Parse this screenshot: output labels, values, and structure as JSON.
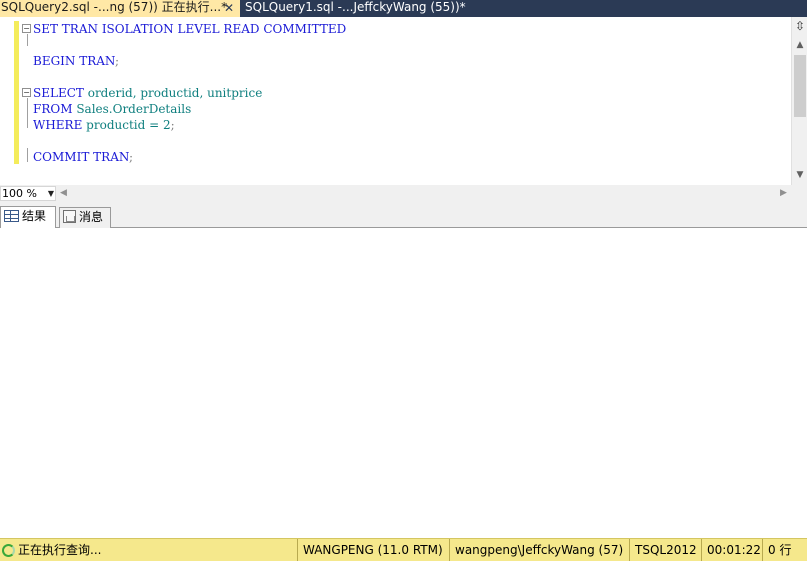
{
  "tabs": [
    {
      "label": "SQLQuery2.sql -...ng (57)) 正在执行...*",
      "active": true,
      "close": "✕"
    },
    {
      "label": "SQLQuery1.sql -...JeffckyWang (55))*",
      "active": false
    }
  ],
  "editor": {
    "lines": {
      "l1": {
        "kw": "SET TRAN ISOLATION LEVEL READ COMMITTED"
      },
      "l2": {
        "kw": "BEGIN TRAN",
        "p": ";"
      },
      "l3": {
        "kw": "SELECT",
        "rest": " orderid, productid, unitprice"
      },
      "l4": {
        "kw": "FROM",
        "obj": " Sales.OrderDetails"
      },
      "l5": {
        "kw": "WHERE",
        "rest": " productid = 2",
        "p": ";"
      },
      "l6": {
        "kw": "COMMIT TRAN",
        "p": ";"
      }
    }
  },
  "zoom": {
    "value": "100 %"
  },
  "result_tabs": {
    "results": "结果",
    "messages": "消息"
  },
  "status": {
    "text": "正在执行查询...",
    "server": "WANGPENG (11.0 RTM)",
    "user": "wangpeng\\JeffckyWang (57)",
    "database": "TSQL2012",
    "elapsed": "00:01:22",
    "rows": "0 行"
  },
  "colors": {
    "tab_active": "#ffe8a6",
    "tabstrip": "#2b3a55",
    "status_bar": "#f5e88c",
    "keyword": "#1a1ad6",
    "object": "#0f7f7f"
  },
  "icons": [
    "close-icon",
    "split-icon",
    "scroll-up-icon",
    "scroll-down-icon",
    "grid-icon",
    "message-icon",
    "spinner-icon"
  ]
}
